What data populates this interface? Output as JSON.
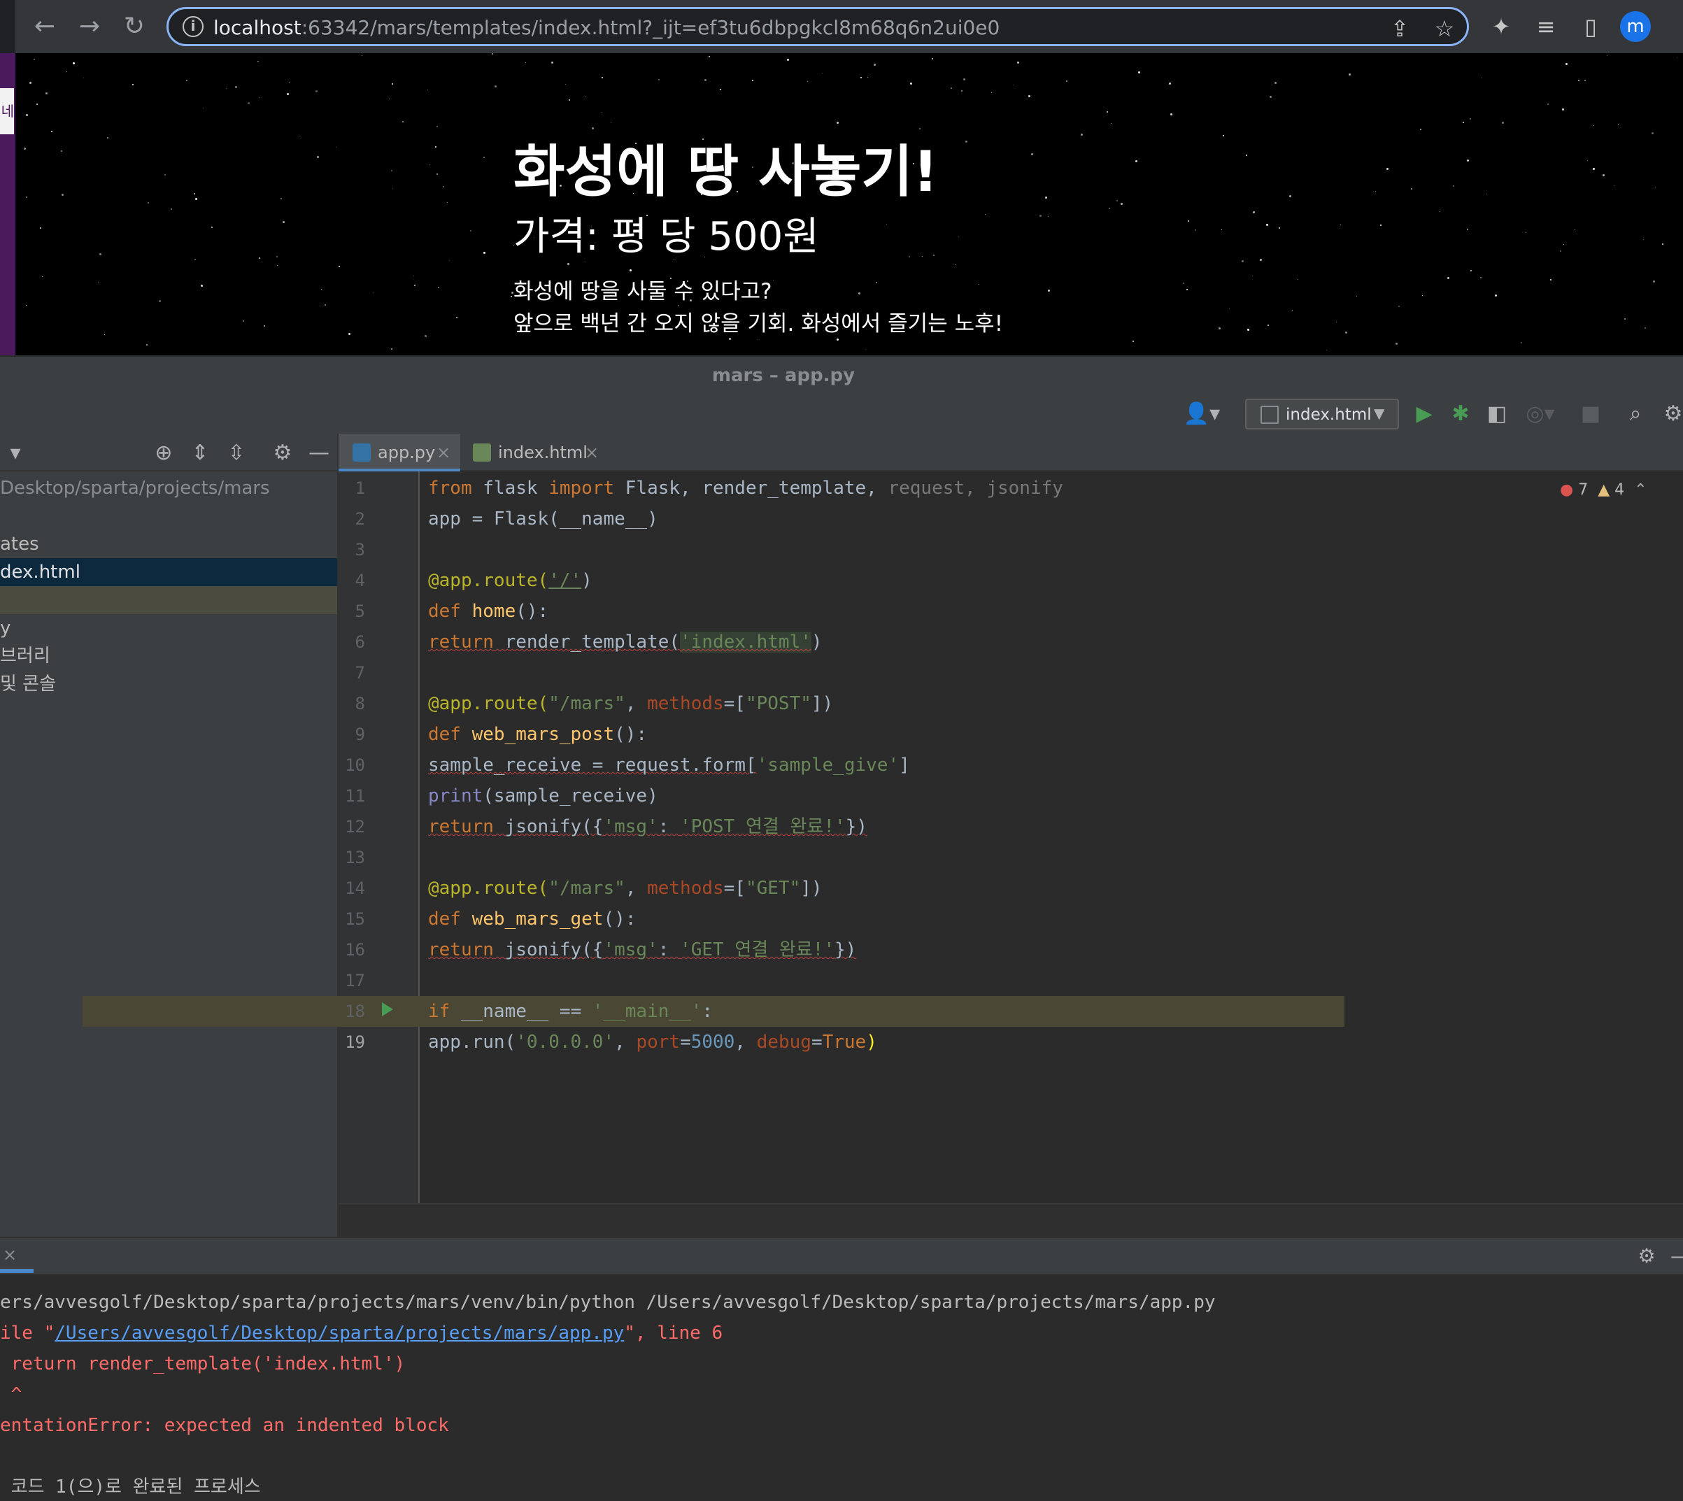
{
  "browser": {
    "url_host": "localhost",
    "url_rest": ":63342/mars/templates/index.html?_ijt=ef3tu6dbpgkcl8m68q6n2ui0e0",
    "profile_initial": "m",
    "icons": [
      "back-icon",
      "forward-icon",
      "reload-icon",
      "info-icon",
      "share-icon",
      "bookmark-star-icon",
      "extensions-icon",
      "media-icon",
      "side-panel-icon"
    ]
  },
  "webpage": {
    "title": "화성에 땅 사놓기!",
    "price": "가격: 평 당 500원",
    "desc_line1": "화성에 땅을 사둘 수 있다고?",
    "desc_line2": "앞으로 백년 간 오지 않을 기회. 화성에서 즐기는 노후!",
    "left_tab_fragment": "네"
  },
  "ide": {
    "window_title": "mars – app.py",
    "run_config": "index.html",
    "project_tree": {
      "path": "Desktop/sparta/projects/mars",
      "items": [
        "ates",
        "dex.html",
        "",
        "y",
        "브러리",
        "및 콘솔"
      ]
    },
    "tabs": [
      {
        "label": "app.py",
        "active": true
      },
      {
        "label": "index.html",
        "active": false
      }
    ],
    "inspections": {
      "errors": "7",
      "warnings": "4"
    },
    "line_numbers": [
      "1",
      "2",
      "3",
      "4",
      "5",
      "6",
      "7",
      "8",
      "9",
      "10",
      "11",
      "12",
      "13",
      "14",
      "15",
      "16",
      "17",
      "18",
      "19"
    ],
    "code": {
      "l1": {
        "a": "from",
        "b": " flask ",
        "c": "import",
        "d": " Flask, render_template, ",
        "e": "request, jsonify"
      },
      "l2": "app = Flask(__name__)",
      "l4": {
        "a": "@app.route(",
        "b": "'/'",
        "c": ")"
      },
      "l5": {
        "a": "def",
        "b": " ",
        "c": "home",
        "d": "():"
      },
      "l6": {
        "a": "return",
        "b": " render_template(",
        "c": "'index.html'",
        "d": ")"
      },
      "l8": {
        "a": "@app.route(",
        "b": "\"/mars\"",
        "c": ", ",
        "d": "methods",
        "e": "=[",
        "f": "\"POST\"",
        "g": "])"
      },
      "l9": {
        "a": "def",
        "b": " ",
        "c": "web_mars_post",
        "d": "():"
      },
      "l10": {
        "a": "sample_receive = request.form[",
        "b": "'sample_give'",
        "c": "]"
      },
      "l11": {
        "a": "print",
        "b": "(sample_receive)"
      },
      "l12": {
        "a": "return",
        "b": " jsonify({",
        "c": "'msg'",
        "d": ": ",
        "e": "'POST 연결 완료!'",
        "f": "})"
      },
      "l14": {
        "a": "@app.route(",
        "b": "\"/mars\"",
        "c": ", ",
        "d": "methods",
        "e": "=[",
        "f": "\"GET\"",
        "g": "])"
      },
      "l15": {
        "a": "def",
        "b": " ",
        "c": "web_mars_get",
        "d": "():"
      },
      "l16": {
        "a": "return",
        "b": " jsonify({",
        "c": "'msg'",
        "d": ": ",
        "e": "'GET 연결 완료!'",
        "f": "})"
      },
      "l18": {
        "a": "if",
        "b": " __name__ == ",
        "c": "'__main__'",
        "d": ":"
      },
      "l19": {
        "a": "app.run(",
        "b": "'0.0.0.0'",
        "c": ", ",
        "d": "port",
        "e": "=",
        "f": "5000",
        "g": ", ",
        "h": "debug",
        "i": "=",
        "j": "True",
        "k": ")"
      }
    },
    "console": {
      "line1": "ers/avvesgolf/Desktop/sparta/projects/mars/venv/bin/python /Users/avvesgolf/Desktop/sparta/projects/mars/app.py",
      "line2_a": "ile \"",
      "line2_link": "/Users/avvesgolf/Desktop/sparta/projects/mars/app.py",
      "line2_b": "\", line 6",
      "line3": " return render_template('index.html')",
      "line4": " ^",
      "line5": "entationError: expected an indented block",
      "line6": " 코드 1(으)로 완료된 프로세스"
    }
  }
}
